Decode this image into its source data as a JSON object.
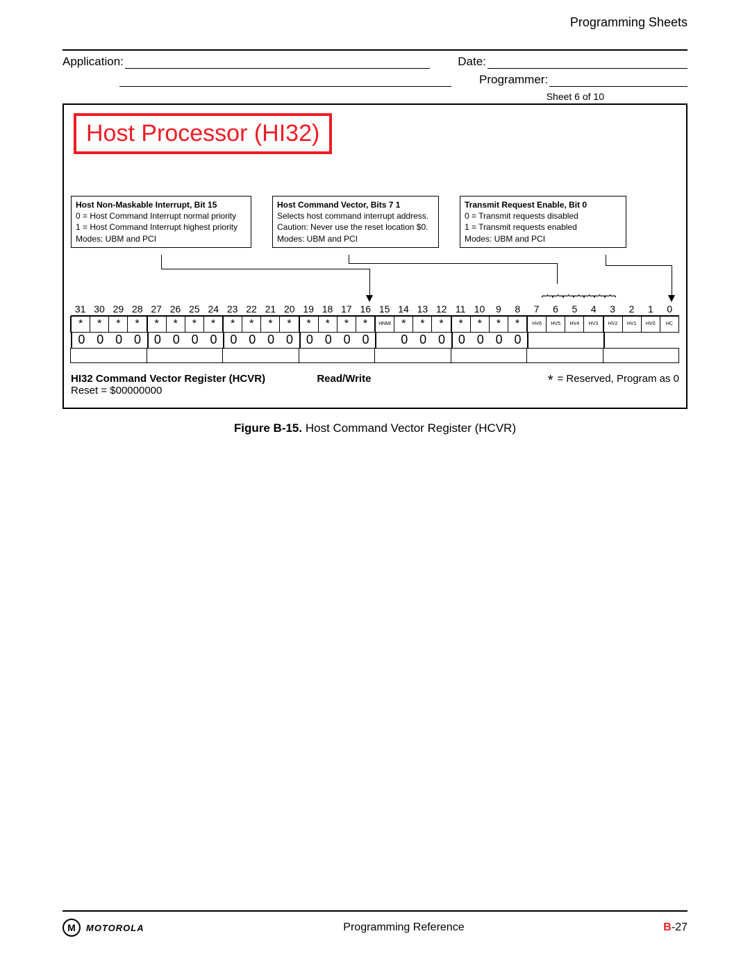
{
  "header": {
    "section": "Programming Sheets"
  },
  "form": {
    "application_label": "Application:",
    "date_label": "Date:",
    "programmer_label": "Programmer:",
    "sheet": "Sheet 6 of 10"
  },
  "block_title": "Host Processor (HI32)",
  "callouts": {
    "c1": {
      "title": "Host Non-Maskable Interrupt, Bit 15",
      "l1": "0 = Host Command Interrupt normal priority",
      "l2": "1 = Host Command Interrupt highest priority",
      "l3": "Modes: UBM and PCI"
    },
    "c2": {
      "title": "Host Command Vector, Bits 7 1",
      "l1": "Selects host command interrupt address.",
      "l2": "Caution: Never use the reset location $0.",
      "l3": "Modes: UBM and PCI"
    },
    "c3": {
      "title": "Transmit Request Enable, Bit 0",
      "l1": "0 = Transmit requests disabled",
      "l2": "1 = Transmit requests enabled",
      "l3": "Modes: UBM and PCI"
    }
  },
  "bits": {
    "numbers": [
      "31",
      "30",
      "29",
      "28",
      "27",
      "26",
      "25",
      "24",
      "23",
      "22",
      "21",
      "20",
      "19",
      "18",
      "17",
      "16",
      "15",
      "14",
      "13",
      "12",
      "11",
      "10",
      "9",
      "8",
      "7",
      "6",
      "5",
      "4",
      "3",
      "2",
      "1",
      "0"
    ],
    "symbols": [
      "*",
      "*",
      "*",
      "*",
      "*",
      "*",
      "*",
      "*",
      "*",
      "*",
      "*",
      "*",
      "*",
      "*",
      "*",
      "*",
      "HNMI",
      "*",
      "*",
      "*",
      "*",
      "*",
      "*",
      "*",
      "HV6",
      "HV5",
      "HV4",
      "HV3",
      "HV2",
      "HV1",
      "HV0",
      "HC"
    ],
    "values": [
      "0",
      "0",
      "0",
      "0",
      "0",
      "0",
      "0",
      "0",
      "0",
      "0",
      "0",
      "0",
      "0",
      "0",
      "0",
      "0",
      "",
      "0",
      "0",
      "0",
      "0",
      "0",
      "0",
      "0",
      "",
      "",
      "",
      "",
      "",
      "",
      "",
      ""
    ],
    "small_idx": [
      16,
      24,
      25,
      26,
      27,
      28,
      29,
      30,
      31
    ],
    "group_starts": [
      0,
      4,
      8,
      12,
      16,
      20,
      24,
      28
    ]
  },
  "register": {
    "name": "HI32 Command Vector Register (HCVR)",
    "access": "Read/Write",
    "reset": "Reset = $00000000",
    "legend_star": "*",
    "legend_text": " = Reserved, Program as 0"
  },
  "caption": {
    "bold": "Figure B-15.",
    "rest": " Host Command Vector Register (HCVR)"
  },
  "footer": {
    "brand": "MOTOROLA",
    "center": "Programming Reference",
    "page_prefix": "B",
    "page_rest": "-27"
  }
}
